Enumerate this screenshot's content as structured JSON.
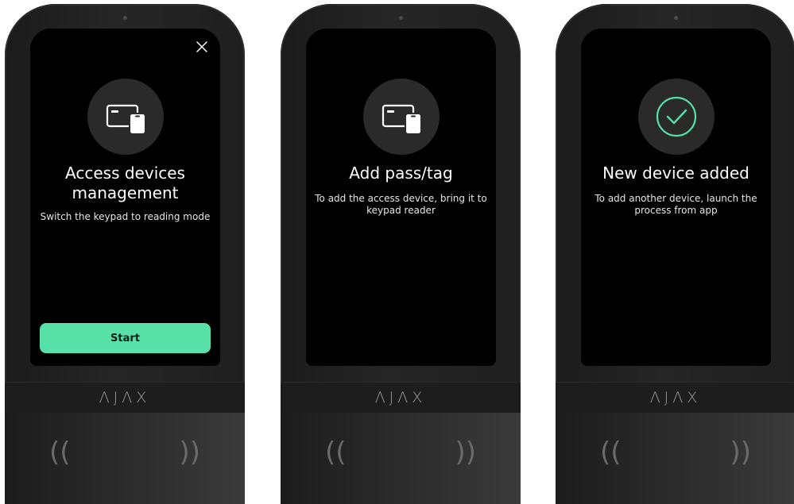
{
  "brand": "ΛJΛX",
  "colors": {
    "accent": "#57E0A7",
    "screen_bg": "#000000",
    "device_body": "#222222",
    "icon_circle": "#2A2A2A"
  },
  "panels": [
    {
      "title": "Access devices management",
      "subtitle": "Switch the keypad to reading mode",
      "icon": "card-tag-icon",
      "button_label": "Start",
      "has_close": true
    },
    {
      "title": "Add pass/tag",
      "subtitle": "To add the access device, bring it to keypad reader",
      "icon": "card-tag-icon"
    },
    {
      "title": "New device added",
      "subtitle": "To add another device, launch the process from app",
      "icon": "success-check-icon"
    }
  ],
  "nfc_glyphs": {
    "left": "((",
    "right": "))"
  }
}
